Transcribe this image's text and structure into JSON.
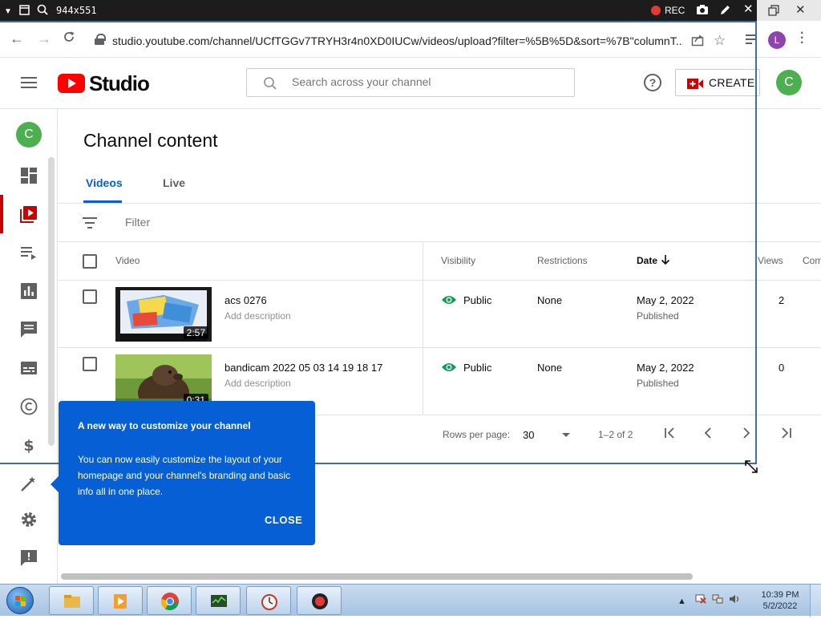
{
  "recorder": {
    "size": "944x551",
    "rec_label": "REC"
  },
  "browser": {
    "url": "studio.youtube.com/channel/UCfTGGv7TRYH3r4n0XD0IUCw/videos/upload?filter=%5B%5D&sort=%7B\"columnT...",
    "profile_initial": "L"
  },
  "header": {
    "logo_text": "Studio",
    "search_placeholder": "Search across your channel",
    "help_glyph": "?",
    "create_label": "CREATE",
    "avatar_initial": "C"
  },
  "sidebar": {
    "avatar_initial": "C",
    "items": [
      "dashboard-icon",
      "content-icon",
      "playlists-icon",
      "analytics-icon",
      "comments-icon",
      "subtitles-icon",
      "copyright-icon",
      "earn-icon",
      "customization-icon",
      "settings-icon",
      "feedback-icon"
    ],
    "active": "content-icon"
  },
  "page": {
    "title": "Channel content",
    "tabs": [
      {
        "label": "Videos"
      },
      {
        "label": "Live"
      }
    ],
    "filter_placeholder": "Filter"
  },
  "table": {
    "columns": {
      "video": "Video",
      "visibility": "Visibility",
      "restrictions": "Restrictions",
      "date": "Date",
      "views": "Views",
      "comments": "Com"
    },
    "rows": [
      {
        "title": "acs 0276",
        "description": "Add description",
        "duration": "2:57",
        "visibility": "Public",
        "restrictions": "None",
        "date": "May 2, 2022",
        "status": "Published",
        "views": "2"
      },
      {
        "title": "bandicam 2022 05 03 14 19 18 17",
        "description": "Add description",
        "duration": "0:31",
        "visibility": "Public",
        "restrictions": "None",
        "date": "May 2, 2022",
        "status": "Published",
        "views": "0"
      }
    ]
  },
  "pagination": {
    "rows_per_page_label": "Rows per page:",
    "rows_per_page": "30",
    "range": "1–2 of 2"
  },
  "tooltip": {
    "title": "A new way to customize your channel",
    "body": "You can now easily customize the layout of your homepage and your channel's branding and basic info all in one place.",
    "close_label": "CLOSE"
  },
  "taskbar": {
    "time": "10:39 PM",
    "date": "5/2/2022"
  },
  "colors": {
    "accent": "#065fd4",
    "brand_red": "#ff0000",
    "active_red": "#cc0000",
    "public_green": "#0f9d58"
  }
}
